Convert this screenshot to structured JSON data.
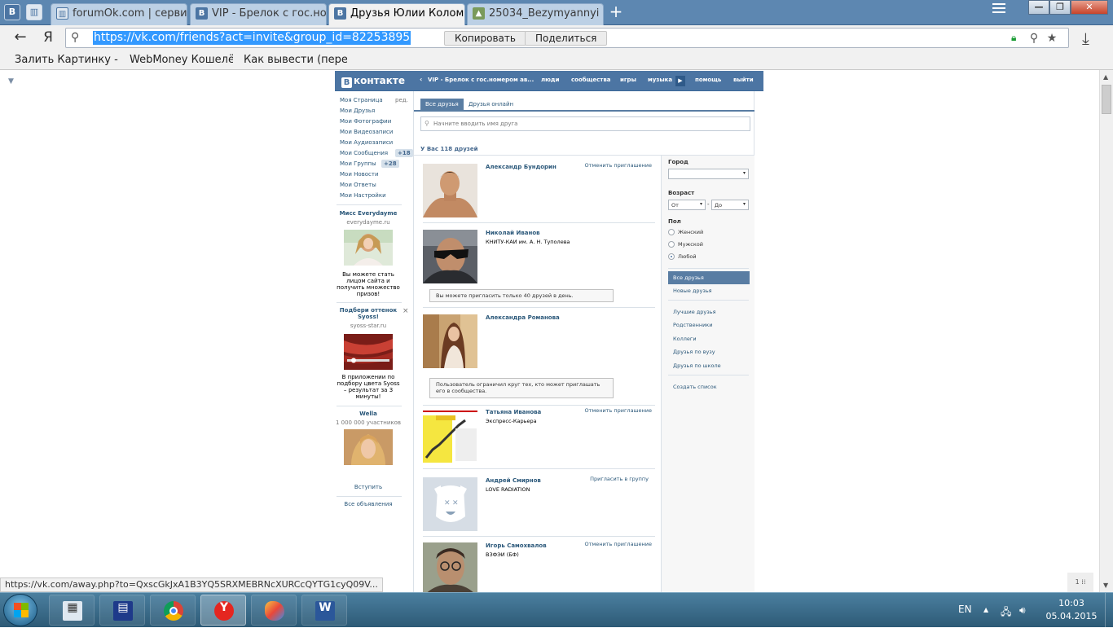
{
  "browser": {
    "tabs": [
      {
        "label": "",
        "icon": "vk"
      },
      {
        "label": "",
        "icon": "bookmarks"
      },
      {
        "label": "forumOk.com | серви",
        "icon": "bookmarks"
      },
      {
        "label": "VIP - Брелок с гос.но",
        "icon": "vk"
      },
      {
        "label": "Друзья Юлии Колом",
        "icon": "vk",
        "active": true
      },
      {
        "label": "25034_Bezymyannyi -",
        "icon": "image"
      }
    ],
    "new_tab": "+",
    "window_buttons": {
      "minimize": "—",
      "maximize": "❐",
      "close": "✕"
    },
    "address": {
      "back": "←",
      "yandex": "Я",
      "url": "https://vk.com/friends?act=invite&group_id=82253895",
      "copy_button": "Копировать",
      "share_button": "Поделиться"
    },
    "bookmarks": [
      "Залить Картинку - З",
      "WebMoney Кошелё",
      "Как вывести (переве"
    ],
    "status_url": "https://vk.com/away.php?to=QxscGkJxA1B3YQ5SRXMEBRNcXURCcQYTG1cyQ09V...",
    "page_indicator": "1 ⁞⁞"
  },
  "vk": {
    "logo": "контакте",
    "logo_letter": "В",
    "header_nav": [
      "VIP - Брелок с гос.номером ав...",
      "люди",
      "сообщества",
      "игры",
      "музыка",
      "помощь",
      "выйти"
    ],
    "left_menu": [
      {
        "label": "Моя Страница",
        "extra": "ред."
      },
      {
        "label": "Мои Друзья"
      },
      {
        "label": "Мои Фотографии"
      },
      {
        "label": "Мои Видеозаписи"
      },
      {
        "label": "Мои Аудиозаписи"
      },
      {
        "label": "Мои Сообщения",
        "badge": "+18"
      },
      {
        "label": "Мои Группы",
        "badge": "+28"
      },
      {
        "label": "Мои Новости"
      },
      {
        "label": "Мои Ответы"
      },
      {
        "label": "Мои Настройки"
      }
    ],
    "ads": [
      {
        "title": "Мисс Everydayme",
        "sub": "everydayme.ru",
        "text": "Вы можете стать лицом сайта и получить множество призов!"
      },
      {
        "title": "Подбери оттенок Syoss!",
        "sub": "syoss-star.ru",
        "text": "В приложении по подбору цвета Syoss – результат за 3 минуты!"
      },
      {
        "title": "Wella",
        "sub": "1 000 000 участников",
        "text": "Вступить"
      }
    ],
    "ad_close": "×",
    "all_ads": "Все объявления",
    "tabs": [
      "Все друзья",
      "Друзья онлайн"
    ],
    "search_placeholder": "Начните вводить имя друга",
    "friends_count": "У Вас 118 друзей",
    "friends": [
      {
        "name": "Александр Бундорин",
        "sub": "",
        "action": "Отменить приглашение",
        "note": ""
      },
      {
        "name": "Николай Иванов",
        "sub": "КНИТУ-КАИ им. А. Н. Туполева",
        "action": "",
        "note": "Вы можете пригласить только 40 друзей в день."
      },
      {
        "name": "Александра Романова",
        "sub": "",
        "action": "",
        "note": "Пользователь ограничил круг тех, кто может приглашать его в сообщества."
      },
      {
        "name": "Татьяна Иванова",
        "sub": "Экспресс-Карьера",
        "action": "Отменить приглашение",
        "note": ""
      },
      {
        "name": "Андрей Смирнов",
        "sub": "LOVE RADIATION",
        "action": "Пригласить в группу",
        "note": ""
      },
      {
        "name": "Игорь Самохвалов",
        "sub": "ВЗФЭИ (БФ)",
        "action": "Отменить приглашение",
        "note": ""
      }
    ],
    "filters": {
      "city_label": "Город",
      "city_value": "",
      "age_label": "Возраст",
      "age_from": "От",
      "age_dash": "-",
      "age_to": "До",
      "sex_label": "Пол",
      "sex_options": [
        "Женский",
        "Мужской",
        "Любой"
      ],
      "sex_selected": "Любой",
      "lists": [
        "Все друзья",
        "Новые друзья"
      ],
      "categories": [
        "Лучшие друзья",
        "Родственники",
        "Коллеги",
        "Друзья по вузу",
        "Друзья по школе"
      ],
      "create_list": "Создать список"
    }
  },
  "taskbar": {
    "apps": [
      "calculator",
      "save-disk",
      "chrome",
      "yandex-browser",
      "paint",
      "word"
    ],
    "language": "EN",
    "time": "10:03",
    "date": "05.04.2015"
  },
  "colors": {
    "vk_blue": "#4c75a3",
    "link": "#2b587a",
    "taskbar": "#2d5a76"
  }
}
